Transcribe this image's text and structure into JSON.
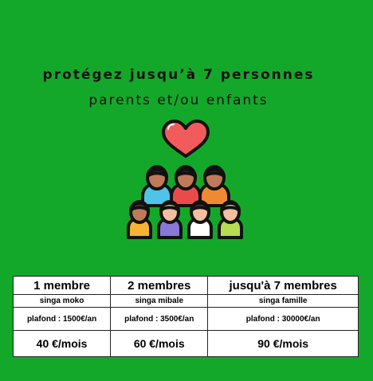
{
  "headline": "protégez jusqu’à 7 personnes",
  "subheadline": "parents et/ou enfants",
  "illustration": {
    "icon": "family-group-heart-icon",
    "colors": {
      "heart": "#f25b5b",
      "background": "#14a82a"
    }
  },
  "plans": [
    {
      "title": "1 membre",
      "name": "singa moko",
      "ceiling": "plafond : 1500€/an",
      "price": "40 €/mois"
    },
    {
      "title": "2 membres",
      "name": "singa mibale",
      "ceiling": "plafond : 3500€/an",
      "price": "60 €/mois"
    },
    {
      "title": "jusqu'à 7 membres",
      "name": "singa famille",
      "ceiling": "plafond : 30000€/an",
      "price": "90 €/mois"
    }
  ]
}
